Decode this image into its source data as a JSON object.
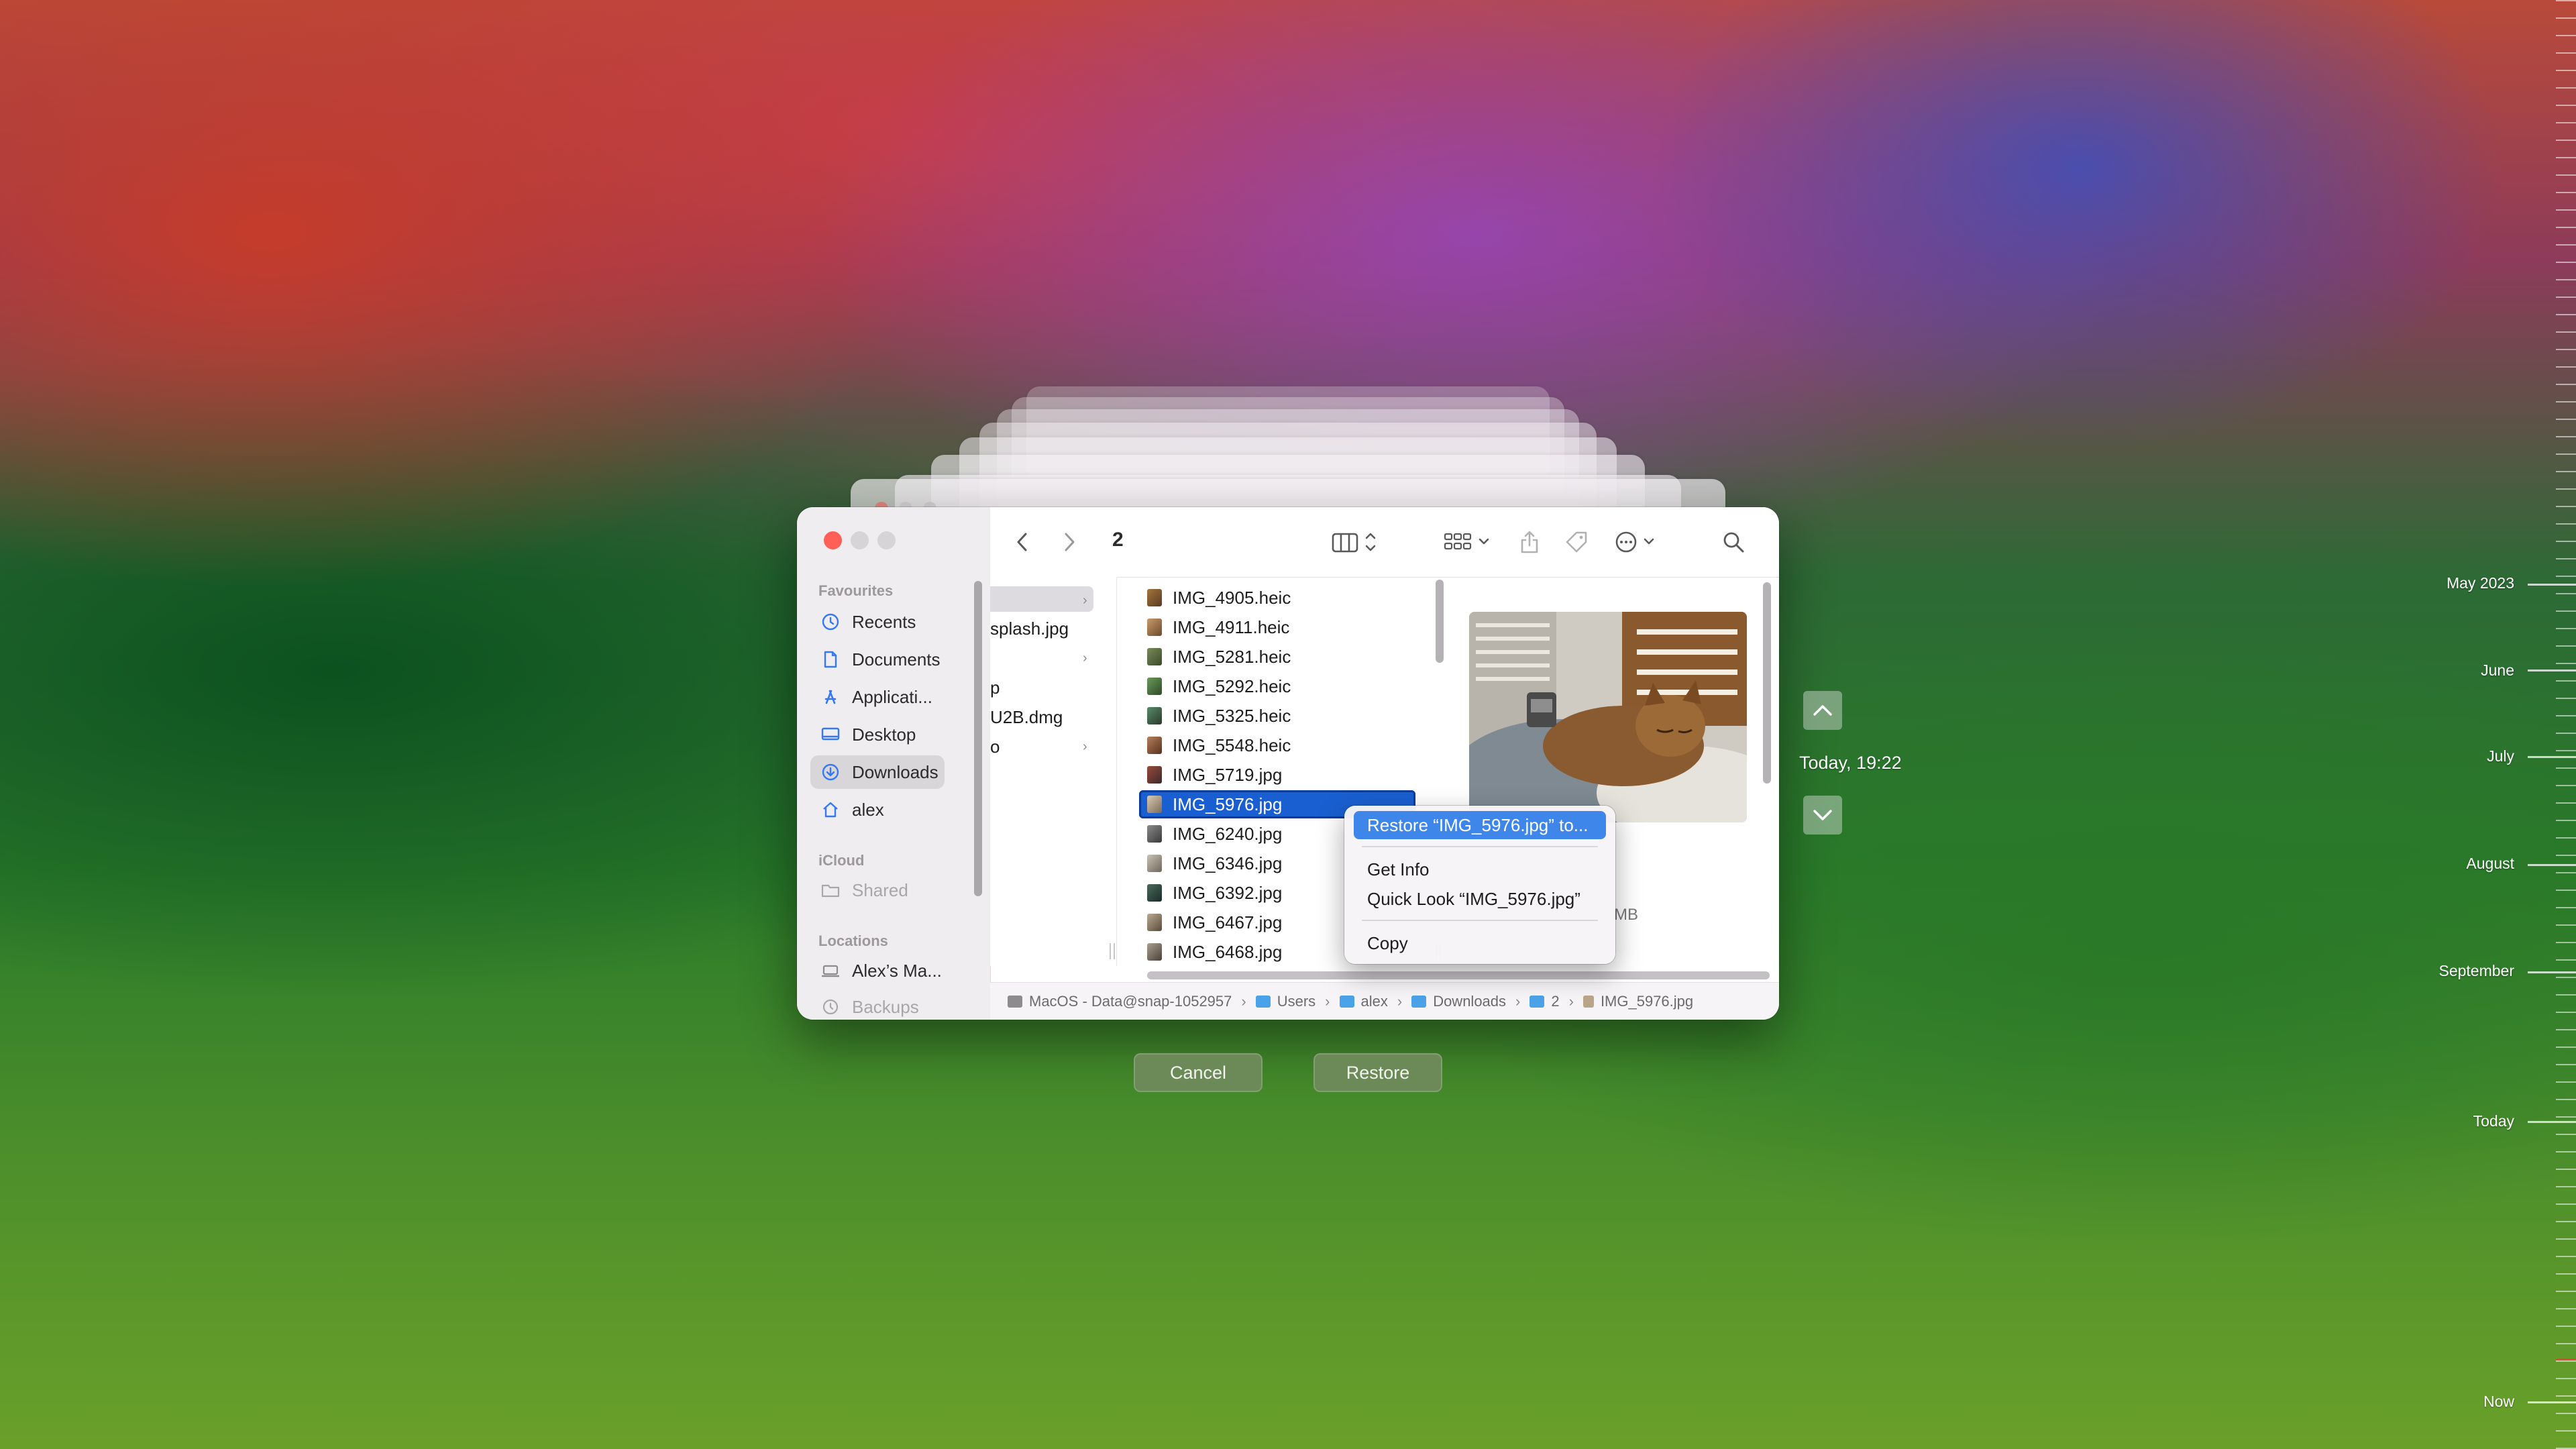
{
  "window": {
    "folder_title": "2"
  },
  "sidebar": {
    "favourites_heading": "Favourites",
    "favourites": [
      {
        "label": "Recents",
        "icon": "clock-icon"
      },
      {
        "label": "Documents",
        "icon": "document-icon"
      },
      {
        "label": "Applicati...",
        "icon": "applications-icon"
      },
      {
        "label": "Desktop",
        "icon": "desktop-icon"
      },
      {
        "label": "Downloads",
        "icon": "download-icon",
        "selected": true
      },
      {
        "label": "alex",
        "icon": "home-icon"
      }
    ],
    "icloud_heading": "iCloud",
    "icloud": [
      {
        "label": "Shared",
        "icon": "shared-folder-icon"
      }
    ],
    "locations_heading": "Locations",
    "locations": [
      {
        "label": "Alex’s Ma...",
        "icon": "laptop-icon"
      },
      {
        "label": "Backups",
        "icon": "time-machine-icon"
      }
    ]
  },
  "column1": {
    "items": [
      "",
      "splash.jpg",
      "",
      "p",
      "U2B.dmg",
      "o"
    ]
  },
  "files": [
    "IMG_4905.heic",
    "IMG_4911.heic",
    "IMG_5281.heic",
    "IMG_5292.heic",
    "IMG_5325.heic",
    "IMG_5548.heic",
    "IMG_5719.jpg",
    "IMG_5976.jpg",
    "IMG_6240.jpg",
    "IMG_6346.jpg",
    "IMG_6392.jpg",
    "IMG_6467.jpg",
    "IMG_6468.jpg"
  ],
  "selected_file": "IMG_5976.jpg",
  "preview": {
    "size_fragment": "MB"
  },
  "context_menu": {
    "restore": "Restore “IMG_5976.jpg” to...",
    "get_info": "Get Info",
    "quick_look": "Quick Look “IMG_5976.jpg”",
    "copy": "Copy"
  },
  "path_bar": {
    "segments": [
      "MacOS - Data@snap-1052957",
      "Users",
      "alex",
      "Downloads",
      "2",
      "IMG_5976.jpg"
    ]
  },
  "buttons": {
    "cancel": "Cancel",
    "restore": "Restore"
  },
  "time_machine": {
    "current_snapshot": "Today, 19:22",
    "timeline_labels": [
      "May 2023",
      "June",
      "July",
      "August",
      "September",
      "Today",
      "Now"
    ]
  },
  "colors": {
    "selection_blue": "#1a5fd1",
    "menu_highlight": "#3f86ea",
    "close_red": "#ff5f57",
    "restore_button": "#6b8a58"
  }
}
